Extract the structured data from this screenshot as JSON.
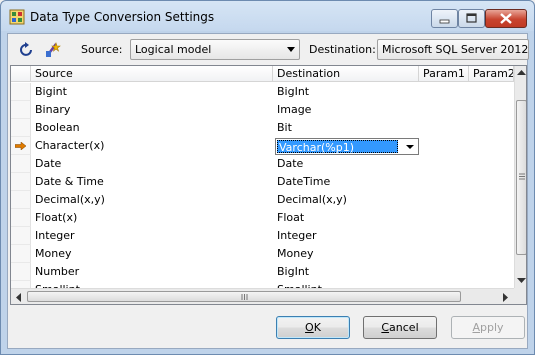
{
  "window": {
    "title": "Data Type Conversion Settings"
  },
  "toolbar": {
    "refresh_icon": "refresh-icon",
    "wizard_icon": "wizard-icon",
    "source_label": "Source:",
    "source_value": "Logical model",
    "destination_label": "Destination:",
    "destination_value": "Microsoft SQL Server 2012"
  },
  "grid": {
    "columns": [
      "Source",
      "Destination",
      "Param1",
      "Param2"
    ],
    "rows": [
      {
        "source": "Bigint",
        "destination": "BigInt"
      },
      {
        "source": "Binary",
        "destination": "Image"
      },
      {
        "source": "Boolean",
        "destination": "Bit"
      },
      {
        "source": "Character(x)",
        "destination": "Varchar(%p1)",
        "current": true
      },
      {
        "source": "Date",
        "destination": "Date"
      },
      {
        "source": "Date & Time",
        "destination": "DateTime"
      },
      {
        "source": "Decimal(x,y)",
        "destination": "Decimal(x,y)"
      },
      {
        "source": "Float(x)",
        "destination": "Float"
      },
      {
        "source": "Integer",
        "destination": "Integer"
      },
      {
        "source": "Money",
        "destination": "Money"
      },
      {
        "source": "Number",
        "destination": "BigInt"
      },
      {
        "source": "Smallint",
        "destination": "Smallint"
      }
    ]
  },
  "buttons": {
    "ok_hotkey": "O",
    "ok_rest": "K",
    "cancel_hotkey": "C",
    "cancel_rest": "ancel",
    "apply_hotkey": "A",
    "apply_rest": "pply"
  },
  "colors": {
    "selection": "#3399ff",
    "pointer": "#e07b00"
  }
}
